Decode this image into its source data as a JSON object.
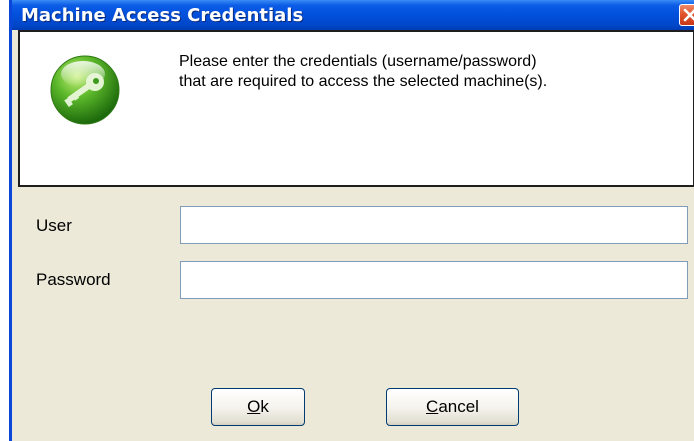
{
  "window": {
    "title": "Machine Access Credentials"
  },
  "header": {
    "icon": "key-icon",
    "message_line1": "Please enter the credentials (username/password)",
    "message_line2": "that are required to access the selected machine(s)."
  },
  "form": {
    "user_label": "User",
    "user_value": "",
    "password_label": "Password",
    "password_value": ""
  },
  "buttons": {
    "ok_mnemonic": "O",
    "ok_rest": "k",
    "cancel_mnemonic": "C",
    "cancel_rest": "ancel"
  },
  "colors": {
    "titlebar": "#0250dc",
    "dialog_background": "#ece9d8",
    "close_button": "#e0542c",
    "icon_green": "#4caf1a"
  }
}
